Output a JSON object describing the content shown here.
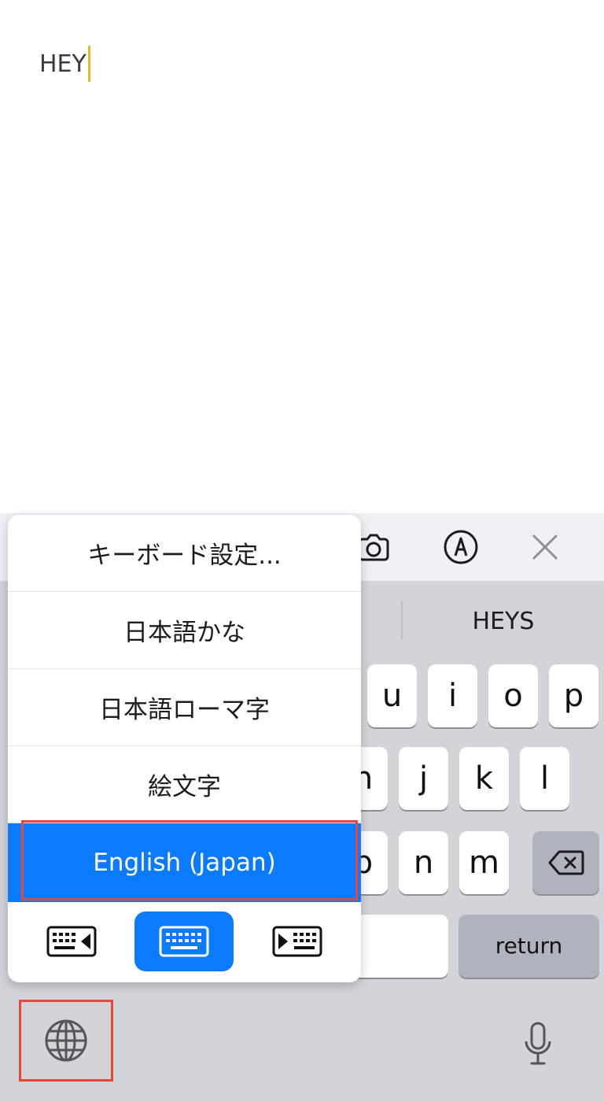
{
  "editor": {
    "text": "HEY"
  },
  "keyboard": {
    "suggestion": "HEYS",
    "rows": {
      "row1": [
        "u",
        "i",
        "o",
        "p"
      ],
      "row2": [
        "h",
        "j",
        "k",
        "l"
      ],
      "row3": [
        "b",
        "n",
        "m"
      ]
    },
    "return_label": "return"
  },
  "popup": {
    "items": [
      {
        "label": "キーボード設定..."
      },
      {
        "label": "日本語かな"
      },
      {
        "label": "日本語ローマ字"
      },
      {
        "label": "絵文字"
      },
      {
        "label": "English (Japan)",
        "selected": true
      }
    ],
    "keyboard_modes": [
      "keyboard-left-icon",
      "keyboard-full-icon",
      "keyboard-right-icon"
    ],
    "active_mode": "keyboard-full-icon"
  },
  "toolbar": {
    "icons": [
      "camera-icon",
      "markup-pen-icon",
      "close-icon"
    ]
  },
  "colors": {
    "accent": "#0a7aff",
    "caret": "#e7b62b",
    "highlight_outline": "#e5483b"
  }
}
